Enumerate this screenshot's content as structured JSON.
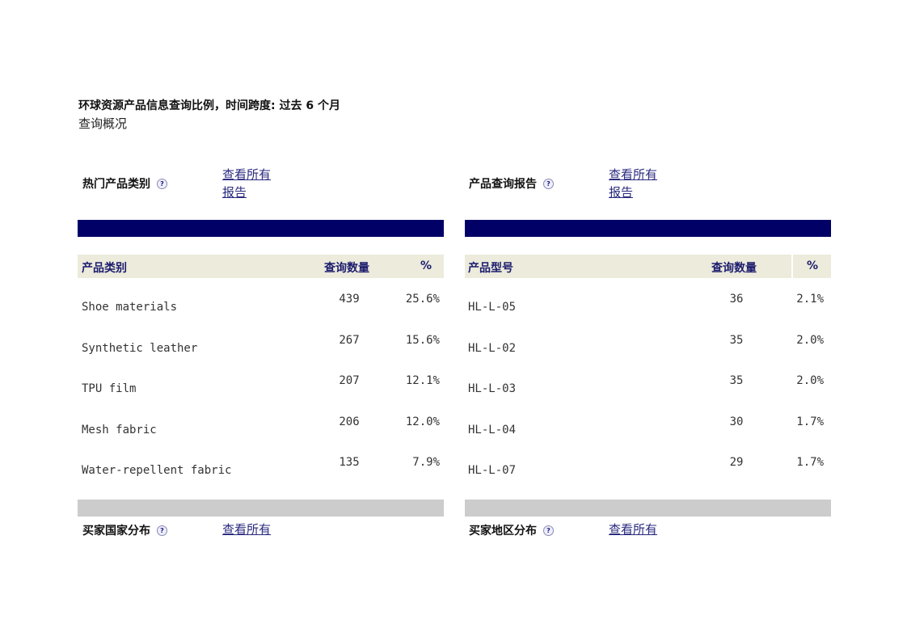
{
  "header": {
    "title": "环球资源产品信息查询比例，时间跨度: 过去 6 个月",
    "subtitle": "查询概况"
  },
  "left_panel": {
    "title": "热门产品类别",
    "help_icon": "help-icon",
    "view_link": "查看所有报告",
    "columns": [
      "产品类别",
      "查询数量",
      "%"
    ],
    "rows": [
      {
        "name": "Shoe materials",
        "count": "439",
        "pct": "25.6%"
      },
      {
        "name": "Synthetic leather",
        "count": "267",
        "pct": "15.6%"
      },
      {
        "name": "TPU film",
        "count": "207",
        "pct": "12.1%"
      },
      {
        "name": "Mesh fabric",
        "count": "206",
        "pct": "12.0%"
      },
      {
        "name": "Water-repellent fabric",
        "count": "135",
        "pct": "7.9%"
      }
    ],
    "footer_title": "买家国家分布",
    "footer_link": "查看所有"
  },
  "right_panel": {
    "title": "产品查询报告",
    "help_icon": "help-icon",
    "view_link": "查看所有报告",
    "columns": [
      "产品型号",
      "查询数量",
      "%"
    ],
    "rows": [
      {
        "name": "HL-L-05",
        "count": "36",
        "pct": "2.1%"
      },
      {
        "name": "HL-L-02",
        "count": "35",
        "pct": "2.0%"
      },
      {
        "name": "HL-L-03",
        "count": "35",
        "pct": "2.0%"
      },
      {
        "name": "HL-L-04",
        "count": "30",
        "pct": "1.7%"
      },
      {
        "name": "HL-L-07",
        "count": "29",
        "pct": "1.7%"
      }
    ],
    "footer_title": "买家地区分布",
    "footer_link": "查看所有"
  },
  "colors": {
    "navy_bar": "#000066",
    "table_header_bg": "#ecebdc",
    "table_header_text": "#1c1c6e",
    "grey_bar": "#cccccc",
    "link": "#2a2a80"
  }
}
